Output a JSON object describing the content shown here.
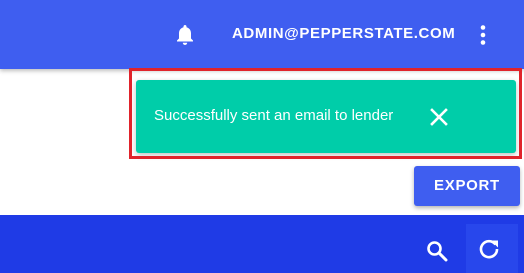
{
  "header": {
    "user_email": "ADMIN@PEPPERSTATE.COM",
    "icons": [
      "bell-icon",
      "more-vert-icon"
    ]
  },
  "toast": {
    "message": "Successfully sent an email to lender",
    "close_icon": "close-icon",
    "color": "#00cda9"
  },
  "actions": {
    "export_label": "EXPORT"
  },
  "toolbar": {
    "icons": [
      "search-icon",
      "refresh-icon"
    ]
  },
  "colors": {
    "primary": "#3f5ef0",
    "toolbar": "#1f3be6",
    "highlight": "#e0232b"
  }
}
